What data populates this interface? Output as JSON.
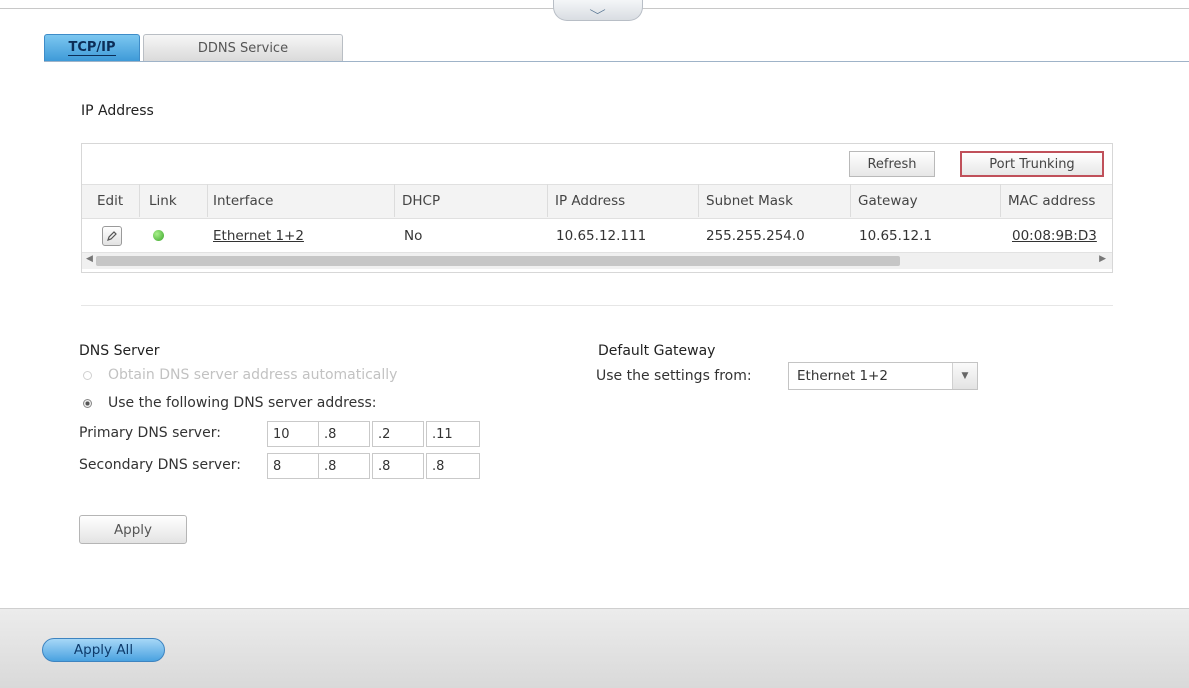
{
  "tabs": [
    {
      "label": "TCP/IP",
      "active": true
    },
    {
      "label": "DDNS Service",
      "active": false
    }
  ],
  "ip_section": {
    "title": "IP Address",
    "refresh_label": "Refresh",
    "port_trunking_label": "Port Trunking",
    "columns": [
      "Edit",
      "Link",
      "Interface",
      "DHCP",
      "IP Address",
      "Subnet Mask",
      "Gateway",
      "MAC address"
    ],
    "rows": [
      {
        "interface": "Ethernet 1+2",
        "dhcp": "No",
        "ip_address": "10.65.12.111",
        "subnet_mask": "255.255.254.0",
        "gateway": "10.65.12.1",
        "mac_address": "00:08:9B:D3",
        "link_status": "connected"
      }
    ]
  },
  "dns": {
    "title": "DNS Server",
    "auto_label": "Obtain DNS server address automatically",
    "manual_label": "Use the following DNS server address:",
    "manual_selected": true,
    "primary_label": "Primary DNS server:",
    "primary": [
      "10",
      ".8",
      ".2",
      ".11"
    ],
    "secondary_label": "Secondary DNS server:",
    "secondary": [
      "8",
      ".8",
      ".8",
      ".8"
    ],
    "apply_label": "Apply"
  },
  "gateway": {
    "title": "Default Gateway",
    "use_settings_label": "Use the settings from:",
    "selected": "Ethernet 1+2"
  },
  "footer": {
    "apply_all_label": "Apply All"
  },
  "colors": {
    "active_tab": "#3e9ad8",
    "highlight_border": "#c0505a",
    "link_led": "#3aa52a",
    "apply_all": "#4aa2e0"
  }
}
